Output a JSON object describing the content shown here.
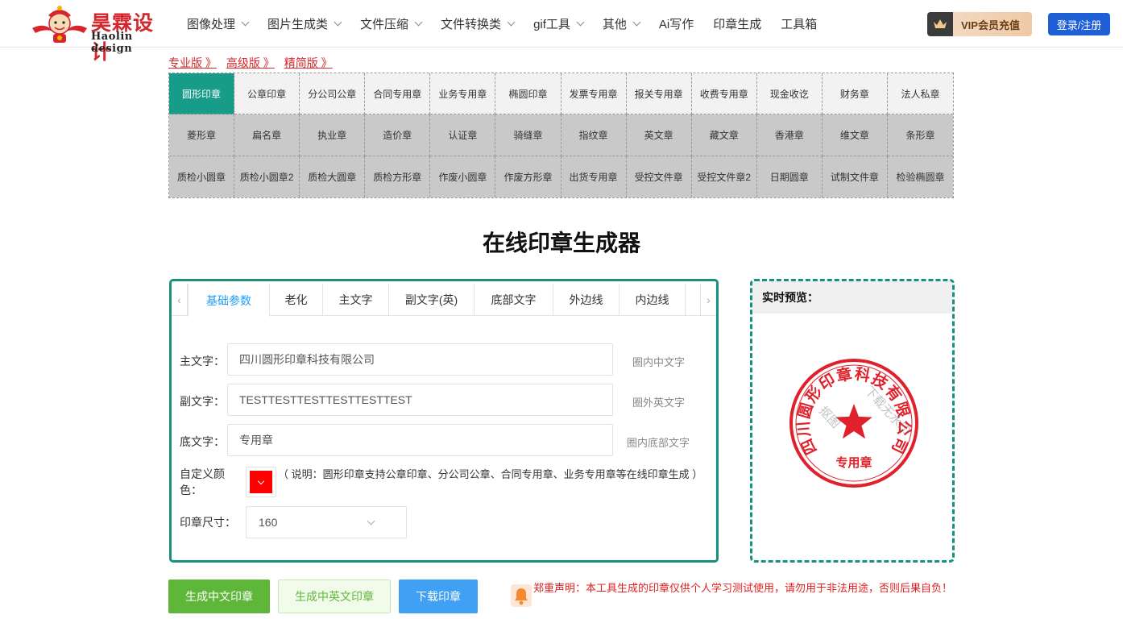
{
  "header": {
    "logo_title": "昊霖设计",
    "logo_subtitle": "Haolin design",
    "nav": [
      {
        "label": "图像处理",
        "dropdown": true
      },
      {
        "label": "图片生成类",
        "dropdown": true
      },
      {
        "label": "文件压缩",
        "dropdown": true
      },
      {
        "label": "文件转换类",
        "dropdown": true
      },
      {
        "label": "gif工具",
        "dropdown": true
      },
      {
        "label": "其他",
        "dropdown": true
      },
      {
        "label": "Ai写作",
        "dropdown": false
      },
      {
        "label": "印章生成",
        "dropdown": false
      },
      {
        "label": "工具箱",
        "dropdown": false
      }
    ],
    "vip_label": "VIP会员充值",
    "login_label": "登录/注册"
  },
  "versions": [
    "专业版 》",
    "高级版 》",
    "精简版 》"
  ],
  "stamp_types": {
    "active_index": 0,
    "rows": [
      [
        "圆形印章",
        "公章印章",
        "分公司公章",
        "合同专用章",
        "业务专用章",
        "椭圆印章",
        "发票专用章",
        "报关专用章",
        "收费专用章",
        "现金收讫",
        "财务章",
        "法人私章"
      ],
      [
        "菱形章",
        "扁名章",
        "执业章",
        "造价章",
        "认证章",
        "骑缝章",
        "指纹章",
        "英文章",
        "藏文章",
        "香港章",
        "维文章",
        "条形章"
      ],
      [
        "质检小圆章",
        "质检小圆章2",
        "质检大圆章",
        "质检方形章",
        "作废小圆章",
        "作废方形章",
        "出货专用章",
        "受控文件章",
        "受控文件章2",
        "日期圆章",
        "试制文件章",
        "检验椭圆章"
      ]
    ]
  },
  "page_title": "在线印章生成器",
  "form": {
    "tab_prev": "‹",
    "tab_next": "›",
    "tabs": [
      "基础参数",
      "老化",
      "主文字",
      "副文字(英)",
      "底部文字",
      "外边线",
      "内边线"
    ],
    "active_tab": 0,
    "main_text": {
      "label": "主文字：",
      "value": "四川圆形印章科技有限公司",
      "hint": "圈内中文字"
    },
    "sub_text": {
      "label": "副文字：",
      "value": "TESTTESTTESTTESTTESTTEST",
      "hint": "圈外英文字"
    },
    "bottom_text": {
      "label": "底文字：",
      "value": "专用章",
      "hint": "圈内底部文字"
    },
    "color": {
      "label": "自定义颜色：",
      "value": "#ff0000",
      "note": "（ 说明：圆形印章支持公章印章、分公司公章、合同专用章、业务专用章等在线印章生成 ）"
    },
    "size": {
      "label": "印章尺寸：",
      "value": "160"
    }
  },
  "preview": {
    "title": "实时预览：",
    "seal_color": "#e0202a",
    "watermark": "下载无水印",
    "watermark2": "抠图"
  },
  "actions": {
    "generate_cn": "生成中文印章",
    "generate_en": "生成中英文印章",
    "download": "下载印章"
  },
  "disclaimer": "郑重声明：本工具生成的印章仅供个人学习测试使用，请勿用于非法用途，否则后果自负！"
}
